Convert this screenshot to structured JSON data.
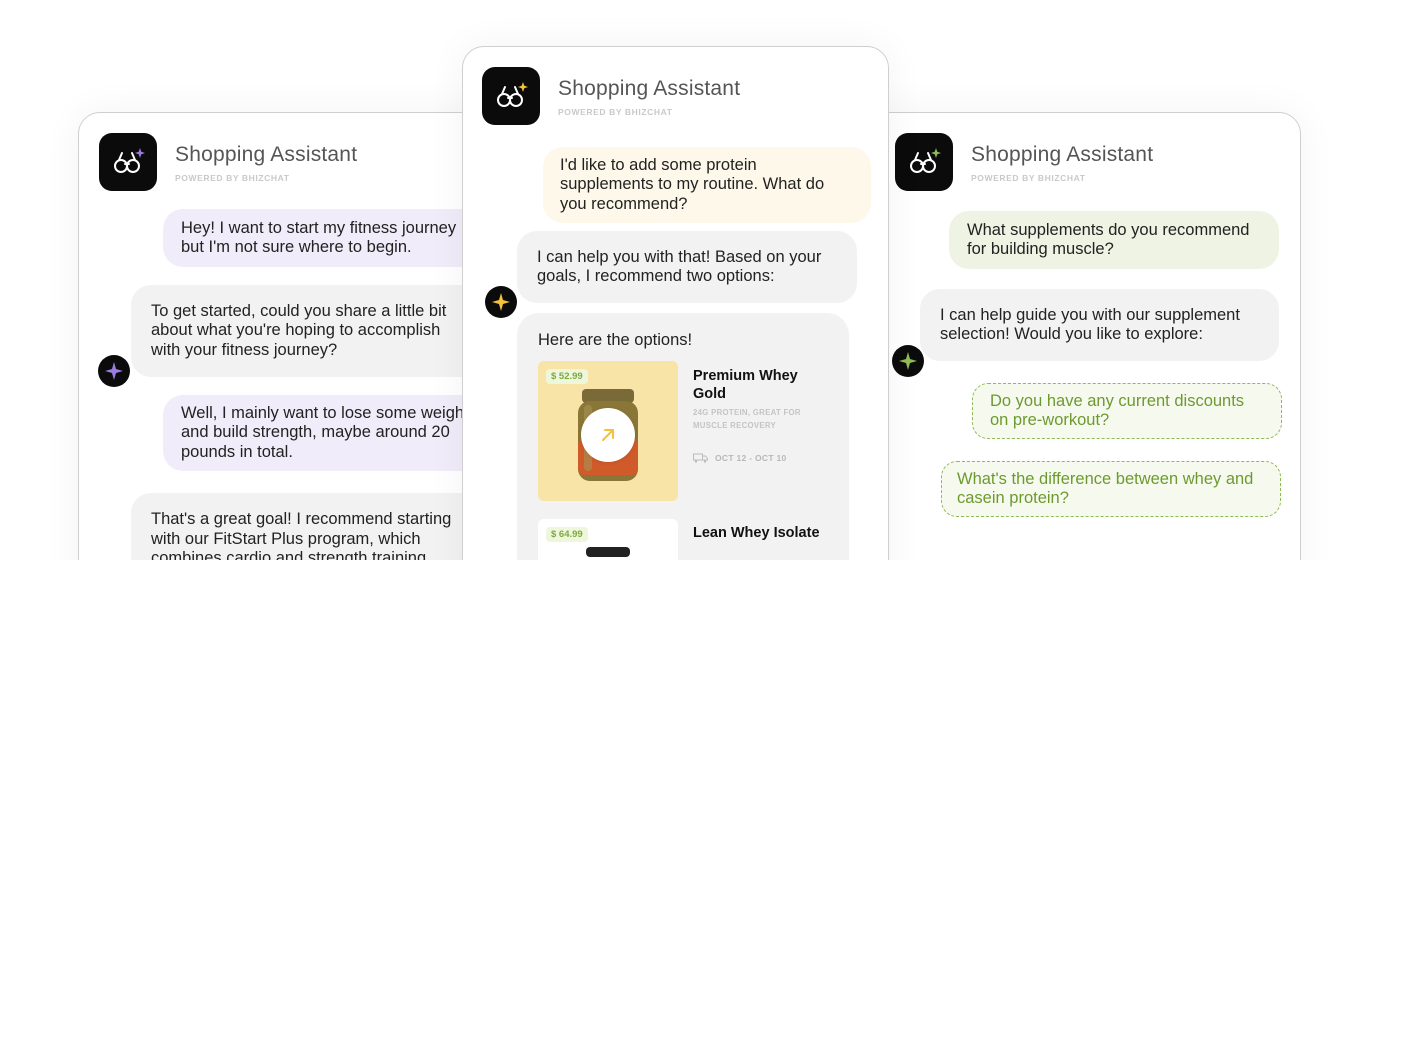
{
  "panels": [
    {
      "id": "left",
      "accent": "#9b7ce0",
      "title": "Shopping Assistant",
      "subtitle": "POWERED BY BHIZCHAT",
      "messages": [
        {
          "role": "user",
          "text": "Hey! I want to start my fitness journey but I'm not sure where to begin."
        },
        {
          "role": "bot",
          "text": "To get started, could you share a little bit about what you're hoping to accomplish with your fitness journey?"
        },
        {
          "role": "user",
          "text": "Well, I mainly want to lose some weight and build strength, maybe around 20 pounds in total."
        },
        {
          "role": "bot",
          "text": "That's a great goal! I recommend starting with our FitStart Plus program, which combines cardio and strength training"
        }
      ]
    },
    {
      "id": "center",
      "accent": "#f3c23a",
      "title": "Shopping Assistant",
      "subtitle": "POWERED BY BHIZCHAT",
      "messages": [
        {
          "role": "user",
          "text": "I'd like to add some protein supplements to my routine. What do you recommend?"
        },
        {
          "role": "bot",
          "text": "I can help you with that! Based on your goals, I recommend two options:"
        }
      ],
      "options_title": "Here are the options!",
      "products": [
        {
          "price": "$ 52.99",
          "name": "Premium Whey Gold",
          "desc": "24G PROTEIN, GREAT FOR MUSCLE RECOVERY",
          "shipping": "OCT 12 - OCT 10",
          "image_bg": "#f9e4a8"
        },
        {
          "price": "$ 64.99",
          "name": "Lean Whey Isolate",
          "image_bg": "#ffffff"
        }
      ]
    },
    {
      "id": "right",
      "accent": "#8fba55",
      "title": "Shopping Assistant",
      "subtitle": "POWERED BY BHIZCHAT",
      "messages": [
        {
          "role": "user",
          "text": "What supplements do you recommend for building muscle?"
        },
        {
          "role": "bot",
          "text": "I can help guide you with our supplement selection! Would you like to explore:"
        }
      ],
      "suggestions": [
        "Do you have any current discounts on pre-workout?",
        "What's the difference between whey and casein protein?"
      ]
    }
  ]
}
